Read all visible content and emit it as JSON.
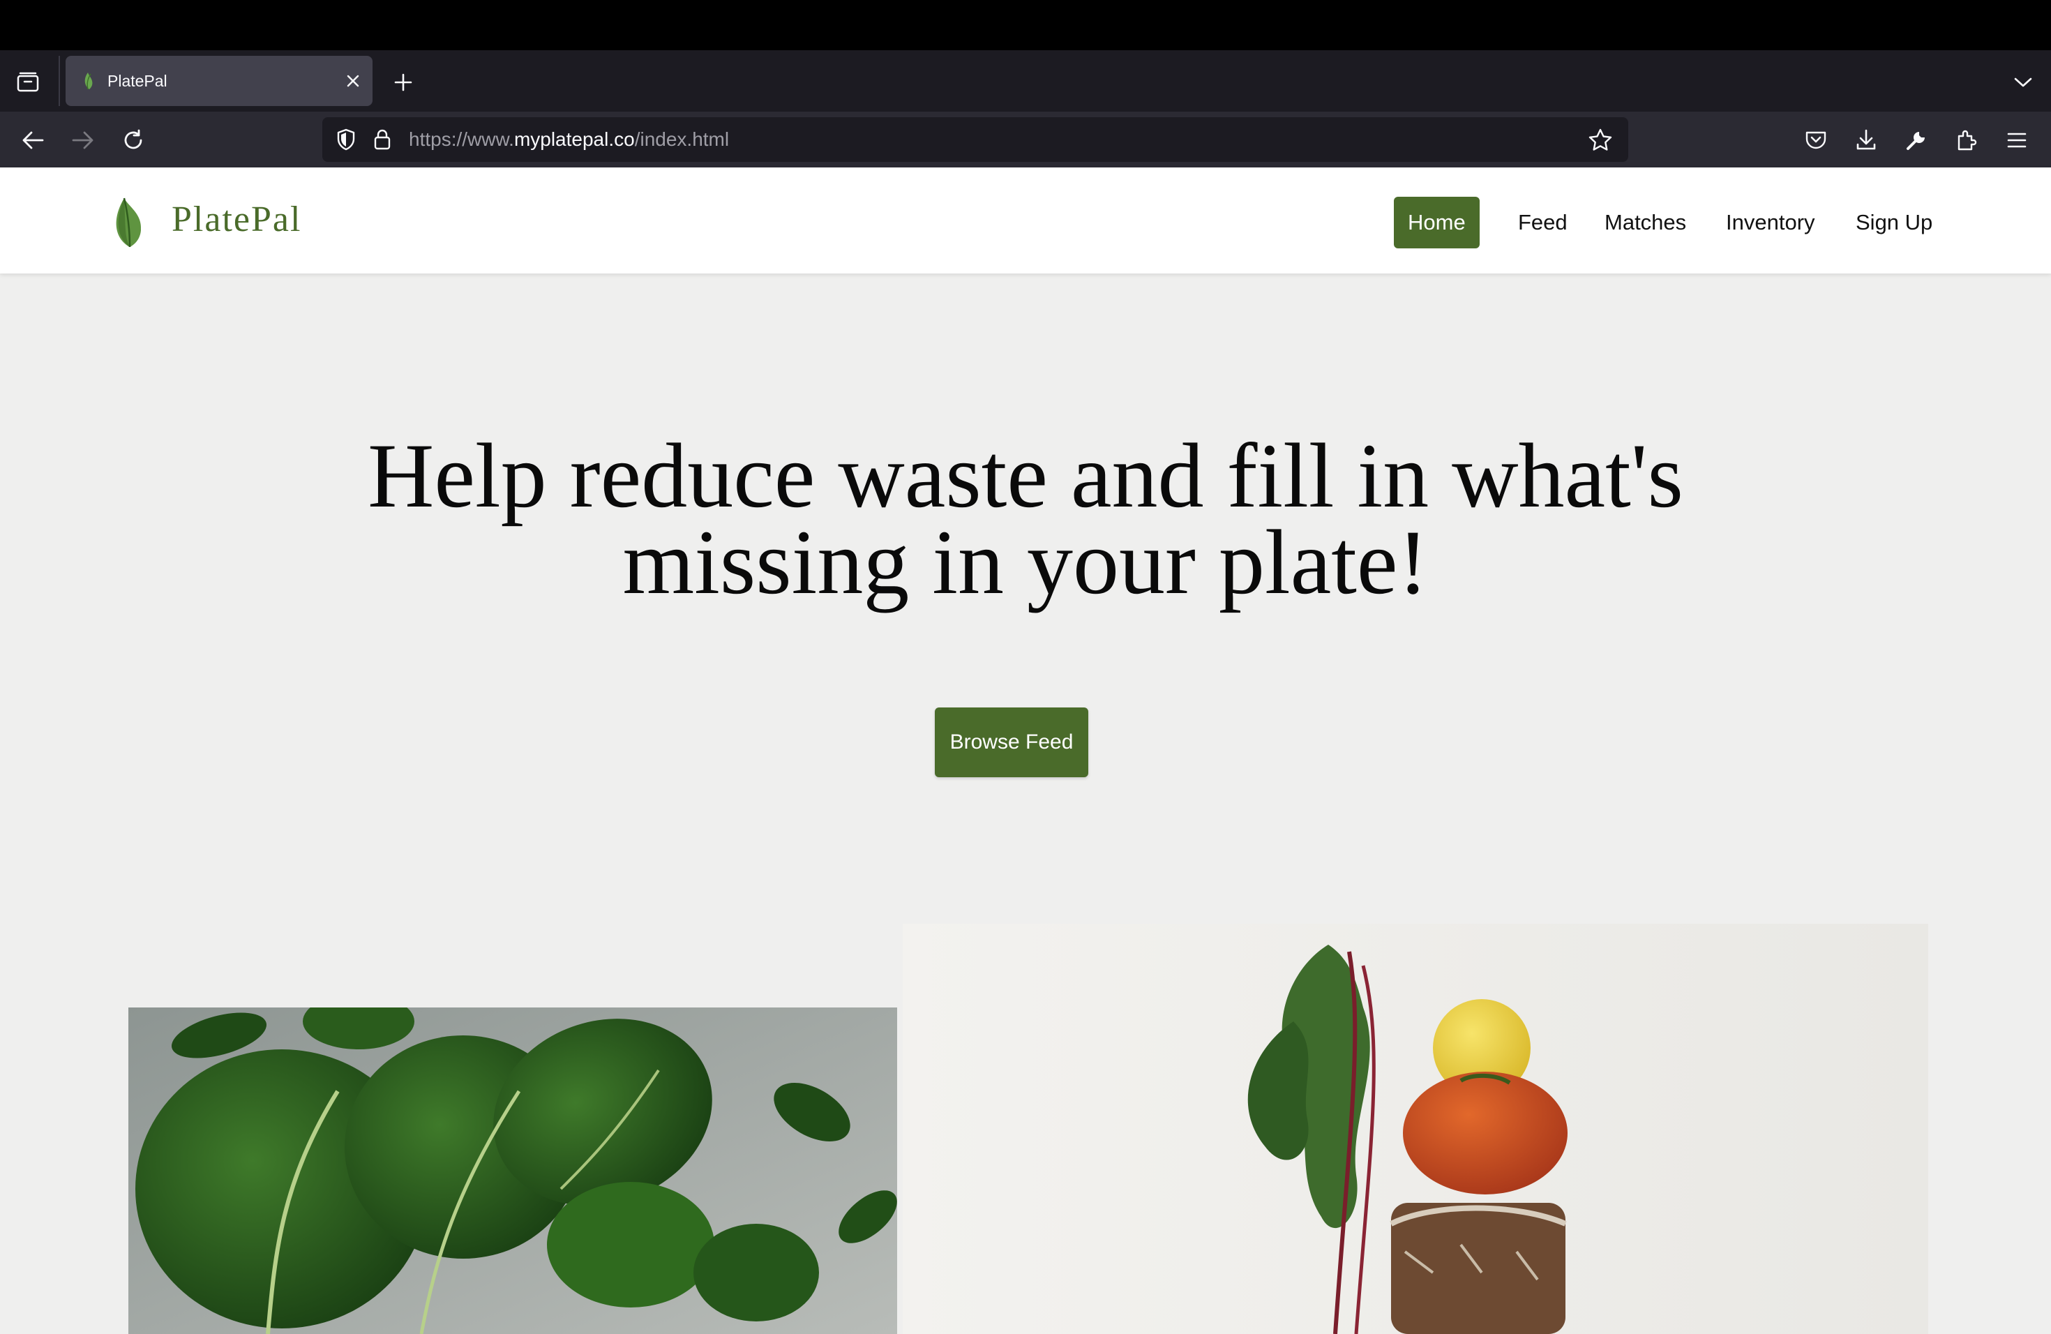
{
  "browser": {
    "tab_title": "PlatePal",
    "url_prefix": "https://www.",
    "url_host": "myplatepal.co",
    "url_path": "/index.html"
  },
  "site": {
    "brand": "PlatePal",
    "nav": {
      "home": "Home",
      "feed": "Feed",
      "matches": "Matches",
      "inventory": "Inventory",
      "signup": "Sign Up"
    },
    "hero_title": "Help reduce waste and fill in what's missing in your plate!",
    "cta_label": "Browse Feed",
    "accent_color": "#4a6b2a"
  },
  "icons": {
    "tabs_overview": "tab-overview-icon",
    "tab_close": "close-icon",
    "new_tab": "plus-icon",
    "tab_list": "chevron-down-icon",
    "back": "arrow-left-icon",
    "forward": "arrow-right-icon",
    "reload": "reload-icon",
    "shield": "shield-icon",
    "lock": "lock-icon",
    "bookmark": "star-icon",
    "pocket": "pocket-icon",
    "downloads": "download-icon",
    "tools": "wrench-icon",
    "extensions": "puzzle-icon",
    "menu": "hamburger-icon"
  }
}
